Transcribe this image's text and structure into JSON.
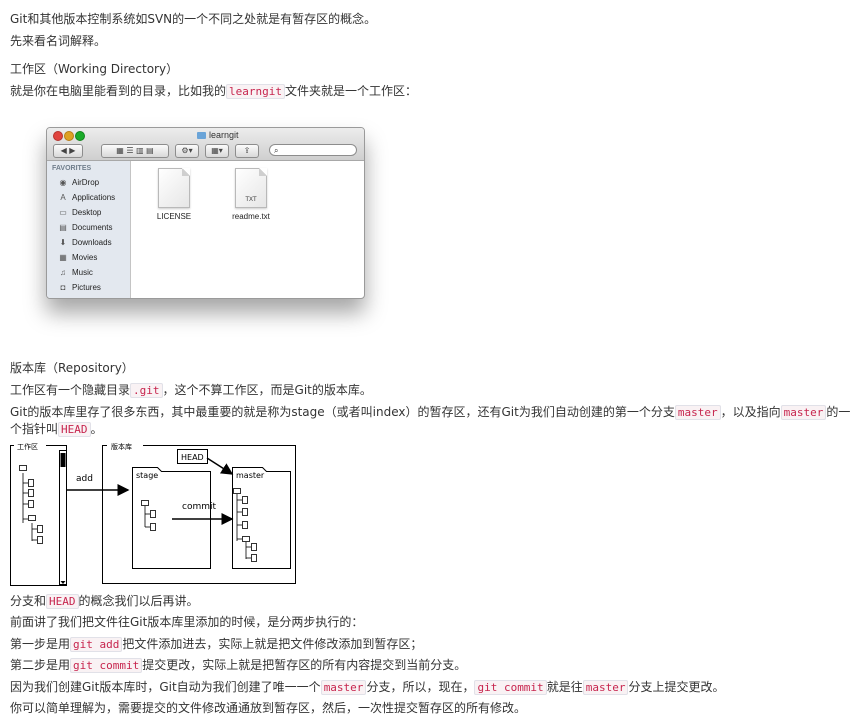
{
  "p1": "Git和其他版本控制系统如SVN的一个不同之处就是有暂存区的概念。",
  "p2": "先来看名词解释。",
  "h_workdir": "工作区（Working Directory）",
  "p3_pre": "就是你在电脑里能看到的目录，比如我的",
  "p3_code": "learngit",
  "p3_post": "文件夹就是一个工作区：",
  "finder": {
    "title": "learngit",
    "favorites_label": "FAVORITES",
    "sidebar": [
      {
        "label": "AirDrop",
        "icon": "airdrop-icon",
        "glyph": "◉"
      },
      {
        "label": "Applications",
        "icon": "applications-icon",
        "glyph": "A"
      },
      {
        "label": "Desktop",
        "icon": "desktop-icon",
        "glyph": "▭"
      },
      {
        "label": "Documents",
        "icon": "documents-icon",
        "glyph": "▤"
      },
      {
        "label": "Downloads",
        "icon": "downloads-icon",
        "glyph": "⬇"
      },
      {
        "label": "Movies",
        "icon": "movies-icon",
        "glyph": "▦"
      },
      {
        "label": "Music",
        "icon": "music-icon",
        "glyph": "♫"
      },
      {
        "label": "Pictures",
        "icon": "pictures-icon",
        "glyph": "◘"
      }
    ],
    "files": [
      {
        "name": "LICENSE",
        "badge": ""
      },
      {
        "name": "readme.txt",
        "badge": "TXT"
      }
    ]
  },
  "h_repo": "版本库（Repository）",
  "p4_pre": "工作区有一个隐藏目录",
  "p4_code": ".git",
  "p4_post": "，这个不算工作区，而是Git的版本库。",
  "p5_a": "Git的版本库里存了很多东西，其中最重要的就是称为stage（或者叫index）的暂存区，还有Git为我们自动创建的第一个分支",
  "p5_code1": "master",
  "p5_b": "，以及指向",
  "p5_code2": "master",
  "p5_c": "的一个指针叫",
  "p5_code3": "HEAD",
  "p5_d": "。",
  "diagram": {
    "workdir_label": "工作区",
    "repo_label": "版本库",
    "add_label": "add",
    "stage_label": "stage",
    "commit_label": "commit",
    "head_label": "HEAD",
    "master_label": "master"
  },
  "p6_pre": "分支和",
  "p6_code": "HEAD",
  "p6_post": "的概念我们以后再讲。",
  "p7": "前面讲了我们把文件往Git版本库里添加的时候，是分两步执行的：",
  "p8_pre": "第一步是用",
  "p8_code": "git add",
  "p8_post": "把文件添加进去，实际上就是把文件修改添加到暂存区；",
  "p9_pre": "第二步是用",
  "p9_code": "git commit",
  "p9_post": "提交更改，实际上就是把暂存区的所有内容提交到当前分支。",
  "p10_a": "因为我们创建Git版本库时，Git自动为我们创建了唯一一个",
  "p10_code1": "master",
  "p10_b": "分支，所以，现在，",
  "p10_code2": "git commit",
  "p10_c": "就是往",
  "p10_code3": "master",
  "p10_d": "分支上提交更改。",
  "p11": "你可以简单理解为，需要提交的文件修改通通放到暂存区，然后，一次性提交暂存区的所有修改。"
}
